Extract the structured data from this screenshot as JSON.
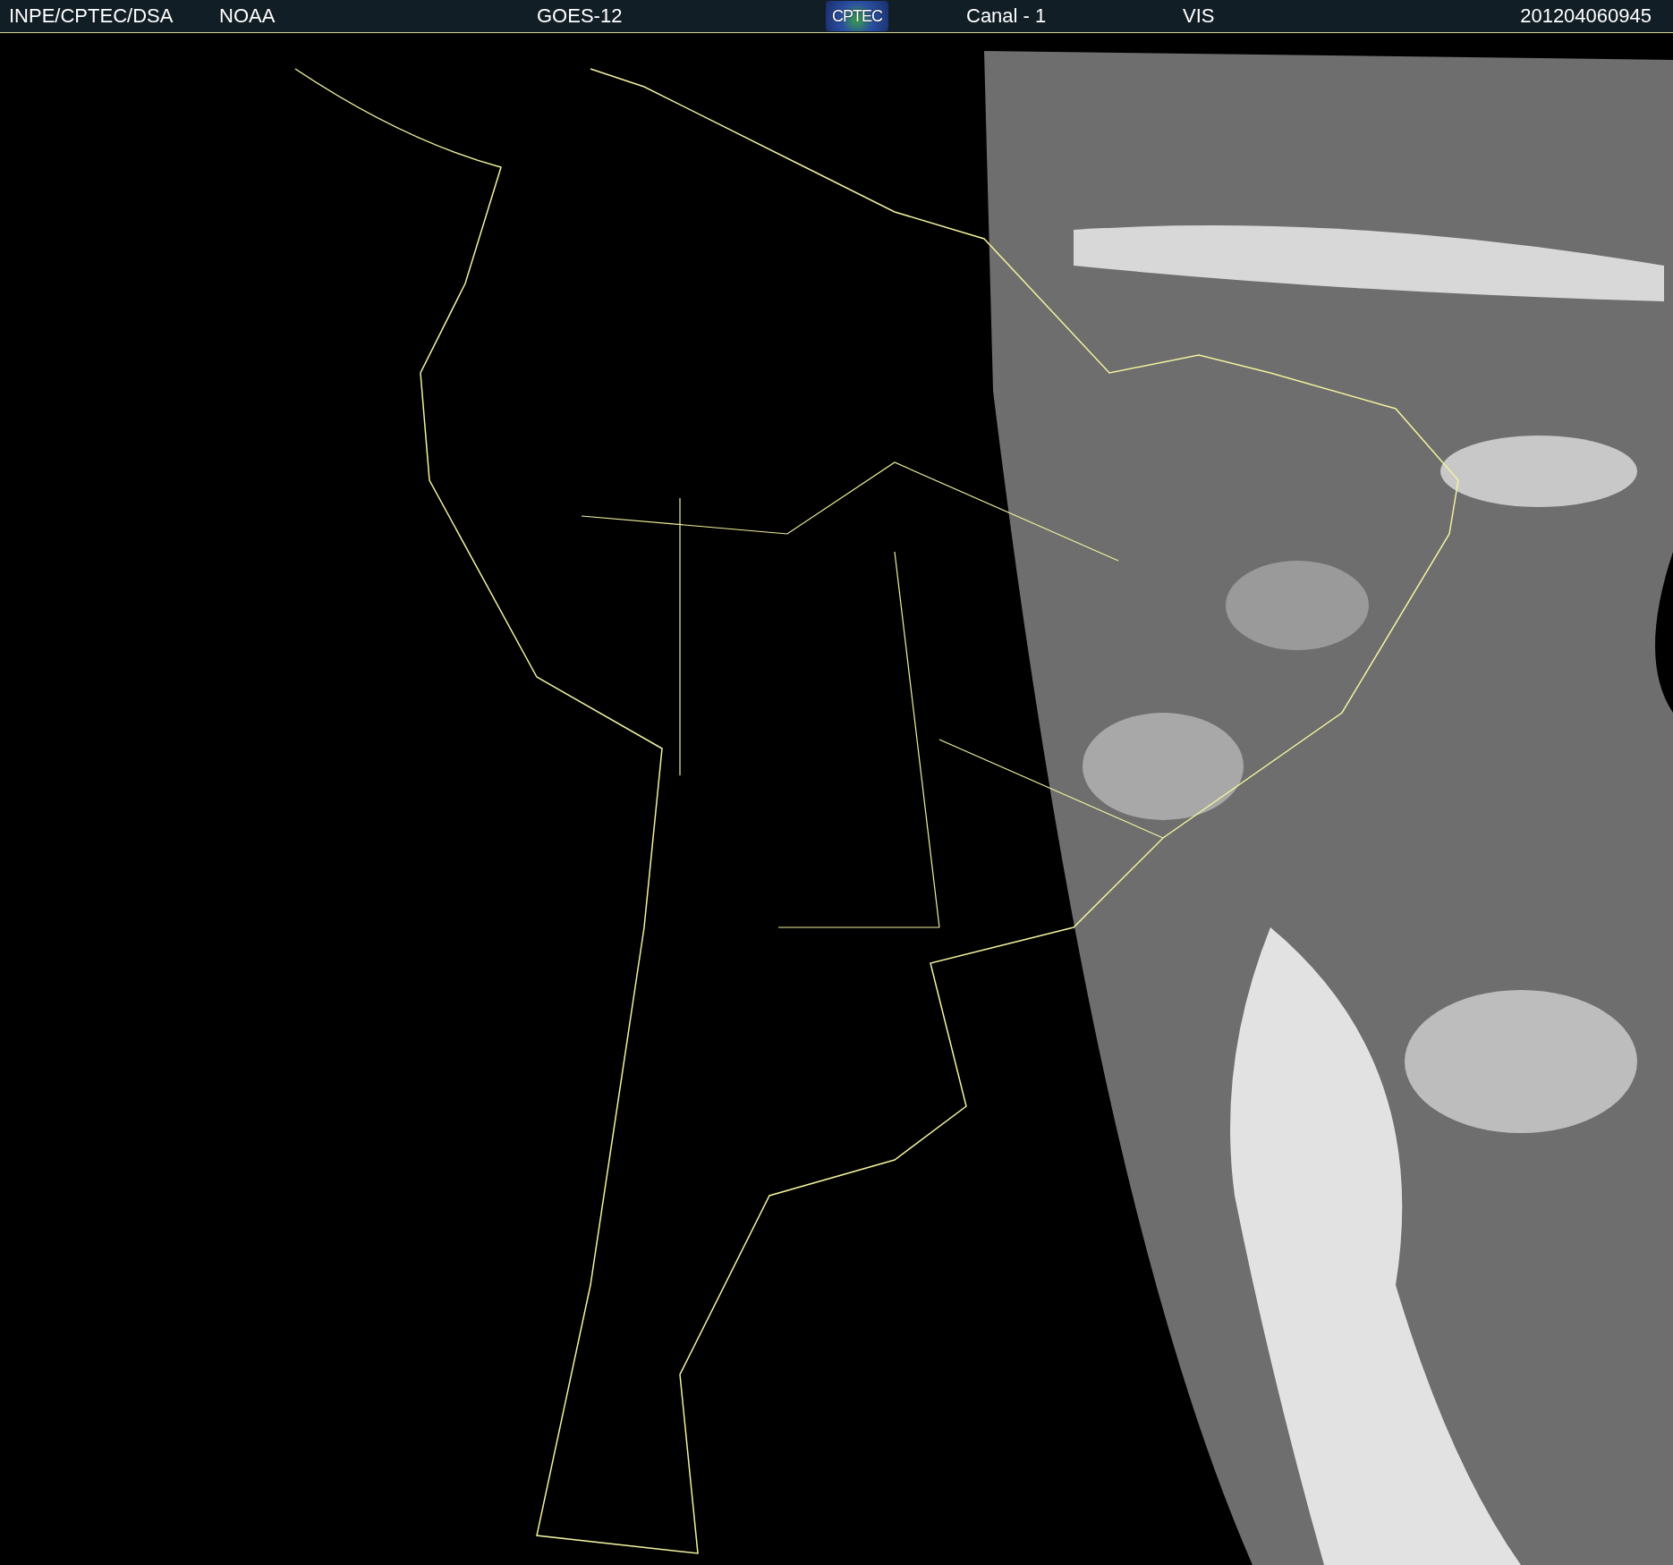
{
  "header": {
    "source": "INPE/CPTEC/DSA",
    "agency": "NOAA",
    "satellite": "GOES-12",
    "logo": "CPTEC",
    "channel": "Canal - 1",
    "band": "VIS",
    "timestamp": "201204060945"
  }
}
